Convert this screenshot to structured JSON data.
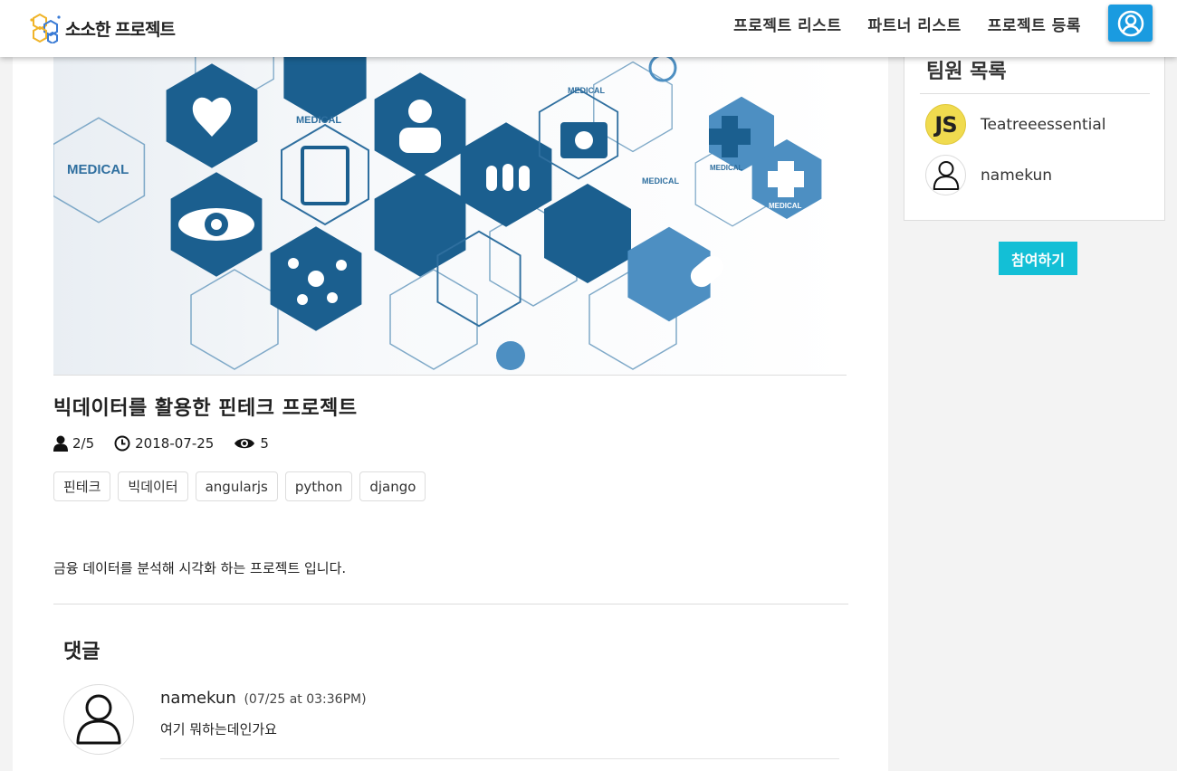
{
  "brand": {
    "name": "소소한 프로젝트",
    "logo_icon": "hexagon-logo-icon"
  },
  "nav": {
    "links": [
      "프로젝트 리스트",
      "파트너 리스트",
      "프로젝트 등록"
    ],
    "profile_icon": "user-circle-icon",
    "accent_color": "#1a9be0"
  },
  "hero": {
    "labels": [
      "MEDICAL",
      "MEDICAL",
      "MEDICAL",
      "MEDICAL",
      "MEDICAL",
      "MEDICAL"
    ]
  },
  "project": {
    "title": "빅데이터를 활용한 핀테크 프로젝트",
    "members": "2/5",
    "date": "2018-07-25",
    "views": "5",
    "tags": [
      "핀테크",
      "빅데이터",
      "angularjs",
      "python",
      "django"
    ],
    "description": "금융 데이터를 분석해 시각화 하는 프로젝트 입니다."
  },
  "comments": {
    "title": "댓글",
    "items": [
      {
        "author": "namekun",
        "time": "(07/25 at 03:36PM)",
        "text": "여기 뭐하는데인가요"
      }
    ]
  },
  "team": {
    "title": "팀원 목록",
    "members": [
      {
        "name": "Teatreeessential",
        "avatar_text": "JS"
      },
      {
        "name": "namekun"
      }
    ]
  },
  "join_button": {
    "label": "참여하기",
    "color": "#13bfd6"
  }
}
